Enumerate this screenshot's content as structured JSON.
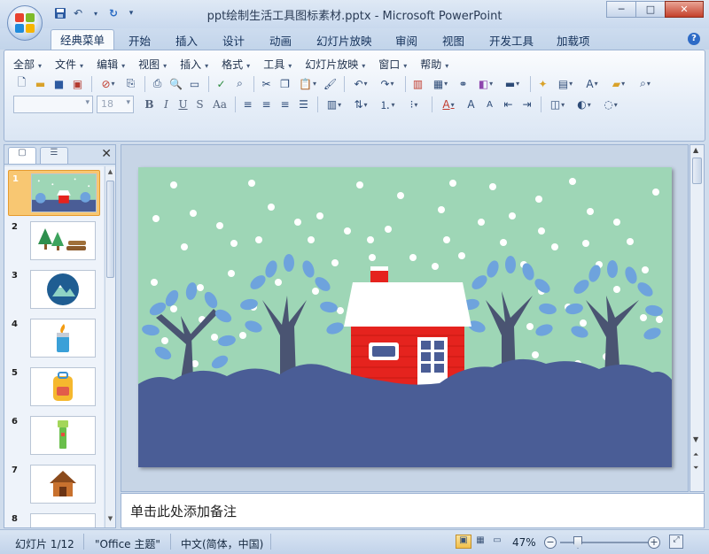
{
  "window": {
    "title": "ppt绘制生活工具图标素材.pptx - Microsoft PowerPoint",
    "controls": [
      "─",
      "□",
      "✕"
    ]
  },
  "tabs": [
    {
      "label": "经典菜单",
      "active": true
    },
    {
      "label": "开始"
    },
    {
      "label": "插入"
    },
    {
      "label": "设计"
    },
    {
      "label": "动画"
    },
    {
      "label": "幻灯片放映"
    },
    {
      "label": "审阅"
    },
    {
      "label": "视图"
    },
    {
      "label": "开发工具"
    },
    {
      "label": "加载项"
    }
  ],
  "classic_menu": [
    {
      "label": "全部"
    },
    {
      "label": "文件"
    },
    {
      "label": "编辑"
    },
    {
      "label": "视图"
    },
    {
      "label": "插入"
    },
    {
      "label": "格式"
    },
    {
      "label": "工具"
    },
    {
      "label": "幻灯片放映"
    },
    {
      "label": "窗口"
    },
    {
      "label": "帮助"
    }
  ],
  "font": {
    "name": "",
    "size": "18"
  },
  "format_buttons": [
    "B",
    "I",
    "U",
    "S",
    "Aa"
  ],
  "panel": {
    "slides": [
      {
        "number": "1",
        "selected": true,
        "icon": "snow-scene-thumbnail"
      },
      {
        "number": "2",
        "icon": "trees-logs-thumbnail"
      },
      {
        "number": "3",
        "icon": "mountain-badge-thumbnail"
      },
      {
        "number": "4",
        "icon": "lighter-thumbnail"
      },
      {
        "number": "5",
        "icon": "backpack-thumbnail"
      },
      {
        "number": "6",
        "icon": "flashlight-thumbnail"
      },
      {
        "number": "7",
        "icon": "cabin-thumbnail"
      },
      {
        "number": "8",
        "icon": "blank-thumbnail"
      }
    ]
  },
  "notes": {
    "placeholder": "单击此处添加备注"
  },
  "status": {
    "slide_position": "幻灯片 1/12",
    "theme": "\"Office 主题\"",
    "language": "中文(简体，中国)",
    "zoom": "47%"
  },
  "colors": {
    "slide_background": "#9ed6b6",
    "ground": "#4a5d96",
    "tree_trunk": "#4a5472",
    "tree_leaves": "#6ea3dd",
    "house_red": "#e5231e",
    "roof_snow": "#ffffff",
    "selection": "#f8c772"
  }
}
